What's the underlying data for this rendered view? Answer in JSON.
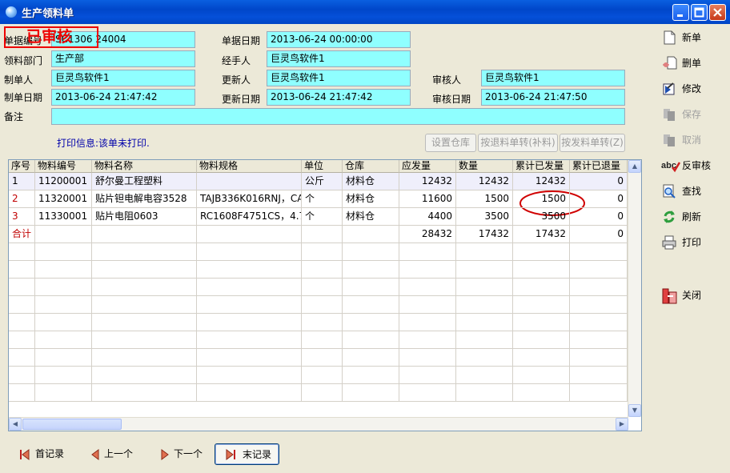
{
  "window": {
    "title": "生产领料单",
    "minimize": "minimize",
    "maximize": "maximize",
    "close": "close"
  },
  "stamp": "已审核",
  "form": {
    "doc_no_label": "单据编号",
    "doc_no": "SC1306 24004",
    "doc_date_label": "单据日期",
    "doc_date": "2013-06-24 00:00:00",
    "dept_label": "领料部门",
    "dept": "生产部",
    "handler_label": "经手人",
    "handler": "巨灵鸟软件1",
    "creator_label": "制单人",
    "creator": "巨灵鸟软件1",
    "updater_label": "更新人",
    "updater": "巨灵鸟软件1",
    "auditor_label": "审核人",
    "auditor": "巨灵鸟软件1",
    "create_date_label": "制单日期",
    "create_date": "2013-06-24 21:47:42",
    "update_date_label": "更新日期",
    "update_date": "2013-06-24 21:47:42",
    "audit_date_label": "审核日期",
    "audit_date": "2013-06-24 21:47:50",
    "remark_label": "备注",
    "remark": ""
  },
  "print_info": "打印信息:该单未打印.",
  "grid_buttons": {
    "set_warehouse": "设置仓库",
    "by_return": "按退料单转(补料)",
    "by_issue": "按发料单转(Z)"
  },
  "table": {
    "headers": [
      "序号",
      "物料编号",
      "物料名称",
      "物料规格",
      "单位",
      "仓库",
      "应发量",
      "数量",
      "累计已发量",
      "累计已退量"
    ],
    "rows": [
      [
        "1",
        "11200001",
        "舒尔曼工程塑料",
        "",
        "公斤",
        "材料仓",
        "12432",
        "12432",
        "12432",
        "0"
      ],
      [
        "2",
        "11320001",
        "贴片钽电解电容3528",
        "TAJB336K016RNJ，CA",
        "个",
        "材料仓",
        "11600",
        "1500",
        "1500",
        "0"
      ],
      [
        "3",
        "11330001",
        "贴片电阻0603",
        "RC1608F4751CS，4.7",
        "个",
        "材料仓",
        "4400",
        "3500",
        "3500",
        "0"
      ]
    ],
    "total": [
      "合计",
      "",
      "",
      "",
      "",
      "",
      "28432",
      "17432",
      "17432",
      "0"
    ]
  },
  "sidebar": [
    {
      "label": "新单",
      "icon": "new-doc-icon",
      "enabled": true
    },
    {
      "label": "删单",
      "icon": "delete-doc-icon",
      "enabled": true
    },
    {
      "label": "修改",
      "icon": "edit-icon",
      "enabled": true
    },
    {
      "label": "保存",
      "icon": "save-icon",
      "enabled": false
    },
    {
      "label": "取消",
      "icon": "cancel-icon",
      "enabled": false
    },
    {
      "label": "反审核",
      "icon": "unaudit-icon",
      "enabled": true
    },
    {
      "label": "查找",
      "icon": "search-icon",
      "enabled": true
    },
    {
      "label": "刷新",
      "icon": "refresh-icon",
      "enabled": true
    },
    {
      "label": "打印",
      "icon": "print-icon",
      "enabled": true
    },
    {
      "label": "关闭",
      "icon": "close-icon",
      "enabled": true
    }
  ],
  "nav": {
    "first": "首记录",
    "prev": "上一个",
    "next": "下一个",
    "last": "末记录"
  },
  "colors": {
    "field_bg": "#8FFFFF",
    "stamp": "#E00000",
    "titlebar": "#0054E3",
    "highlight_circle": "#D00000"
  }
}
